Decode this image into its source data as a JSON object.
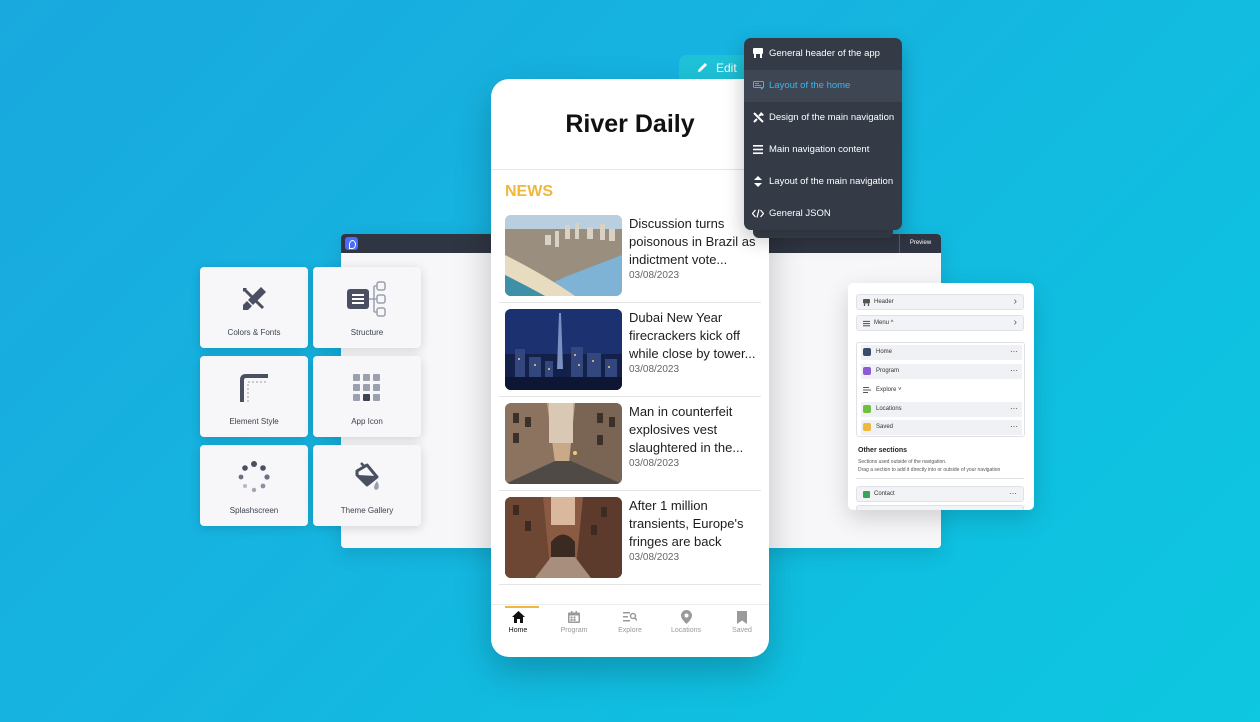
{
  "phone": {
    "title": "River Daily",
    "section_heading": "NEWS",
    "articles": [
      {
        "headline": "Discussion turns poisonous in Brazil as indictment vote...",
        "date": "03/08/2023"
      },
      {
        "headline": "Dubai New Year firecrackers kick off while close by tower...",
        "date": "03/08/2023"
      },
      {
        "headline": "Man in counterfeit explosives vest slaughtered in the...",
        "date": "03/08/2023"
      },
      {
        "headline": "After 1 million transients, Europe's fringes are back",
        "date": "03/08/2023"
      }
    ],
    "tabs": [
      {
        "label": "Home",
        "icon": "home-icon"
      },
      {
        "label": "Program",
        "icon": "calendar-icon"
      },
      {
        "label": "Explore",
        "icon": "explore-list-icon"
      },
      {
        "label": "Locations",
        "icon": "location-pin-icon"
      },
      {
        "label": "Saved",
        "icon": "bookmark-icon"
      }
    ],
    "accent_color": "#f0b73d"
  },
  "edit_tab": {
    "label": "Edit"
  },
  "edit_menu": {
    "items": [
      {
        "label": "General header of the app",
        "icon": "header-icon"
      },
      {
        "label": "Layout of the home",
        "icon": "layout-icon"
      },
      {
        "label": "Design of the main navigation",
        "icon": "design-tools-icon"
      },
      {
        "label": "Main navigation content",
        "icon": "menu-lines-icon"
      },
      {
        "label": "Layout of the main navigation",
        "icon": "up-down-icon"
      },
      {
        "label": "General JSON",
        "icon": "code-icon"
      }
    ],
    "active_index": 1,
    "active_color": "#39b6f2"
  },
  "editor": {
    "preview_label": "Preview"
  },
  "tiles": [
    {
      "label": "Colors & Fonts",
      "icon": "paint-brush-icon"
    },
    {
      "label": "Structure",
      "icon": "structure-tree-icon"
    },
    {
      "label": "Element Style",
      "icon": "corner-style-icon"
    },
    {
      "label": "App Icon",
      "icon": "app-grid-icon"
    },
    {
      "label": "Splashscreen",
      "icon": "loading-spinner-icon"
    },
    {
      "label": "Theme Gallery",
      "icon": "paint-bucket-icon"
    }
  ],
  "nav_panel": {
    "header_label": "Header",
    "menu_label": "Menu ^",
    "items": [
      {
        "label": "Home",
        "color": "#3a4a6b"
      },
      {
        "label": "Program",
        "color": "#8e5bd6"
      },
      {
        "label": "Explore ˅",
        "color": ""
      },
      {
        "label": "Locations",
        "color": "#6fbf3a"
      },
      {
        "label": "Saved",
        "color": "#f0b73d"
      }
    ],
    "other_title": "Other sections",
    "other_desc_1": "Sections used outside of the navigation.",
    "other_desc_2": "Drag a section to add it directly into or outside of your navigation",
    "contact_label": "Contact",
    "contact_color": "#3aa55a"
  }
}
